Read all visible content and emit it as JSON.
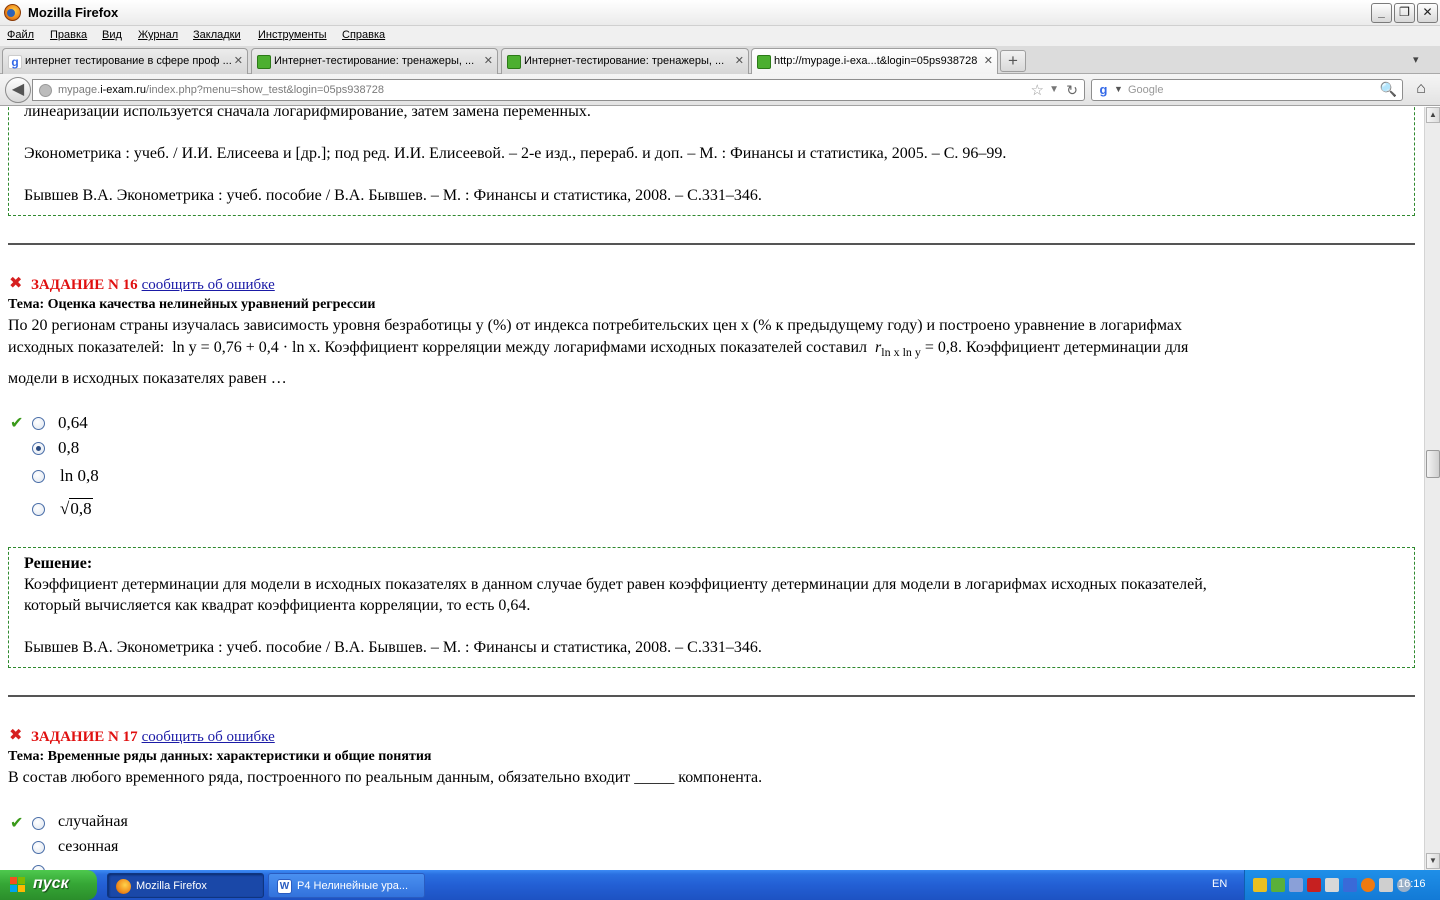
{
  "window": {
    "title": "Mozilla Firefox",
    "buttons": {
      "minimize": "_",
      "maximize": "❐",
      "close": "✕"
    }
  },
  "menu": [
    "Файл",
    "Правка",
    "Вид",
    "Журнал",
    "Закладки",
    "Инструменты",
    "Справка"
  ],
  "tabs": [
    {
      "label": "интернет тестирование в сфере проф ...",
      "close": "✕",
      "icon": "google-icon"
    },
    {
      "label": "Интернет-тестирование: тренажеры, ...",
      "close": "✕",
      "icon": "iexam-icon"
    },
    {
      "label": "Интернет-тестирование: тренажеры, ...",
      "close": "✕",
      "icon": "iexam-icon"
    },
    {
      "label": "http://mypage.i-exa...t&login=05ps938728",
      "close": "✕",
      "icon": "iexam-icon"
    }
  ],
  "new_tab": "+",
  "tabs_dropdown": "▾",
  "nav": {
    "back": "◀",
    "url_prefix": "mypage.",
    "url_domain": "i-exam.ru",
    "url_rest": "/index.php?menu=show_test&login=05ps938728",
    "star": "☆",
    "dropdown": "▼",
    "reload": "↻",
    "search_engine": "g",
    "search_dropdown": "▼",
    "search_placeholder": "Google",
    "search_button": "🔍",
    "home": "⌂"
  },
  "content": {
    "prev_solution": {
      "line_cut": "линеаризации используется сначала логарифмирование, затем замена переменных.",
      "ref1": "Эконометрика : учеб. / И.И. Елисеева и [др.]; под ред. И.И. Елисеевой. – 2-е изд., перераб. и доп. – М. : Финансы и статистика, 2005. – С. 96–99.",
      "ref2": "Бывшев В.А. Эконометрика : учеб. пособие / В.А. Бывшев. – М. : Финансы и статистика, 2008. – С.331–346."
    },
    "task16": {
      "title": "ЗАДАНИЕ N 16",
      "report": "сообщить об ошибке",
      "topic": "Тема: Оценка качества нелинейных уравнений регрессии",
      "q_line1": "По 20 регионам страны изучалась зависимость уровня безработицы y (%) от индекса потребительских цен x (% к предыдущему году) и построено уравнение в логарифмах",
      "q_line2_a": "исходных показателей:",
      "formula": "ln y = 0,76 + 0,4 · ln x",
      "q_line2_b": ". Коэффициент корреляции между логарифмами исходных показателей составил",
      "corr_formula": "r",
      "corr_sub": "ln x ln y",
      "corr_value": "= 0,8",
      "q_line2_c": ". Коэффициент детерминации для",
      "q_line3": "модели в исходных показателях равен …",
      "options": [
        "0,64",
        "0,8",
        "ln 0,8",
        "0,8"
      ],
      "correct_index": 0,
      "selected_index": 1,
      "solution_title": "Решение:",
      "solution_line1": "Коэффициент детерминации для модели в исходных показателях в данном случае будет равен коэффициенту детерминации для модели в логарифмах исходных показателей,",
      "solution_line2": "который вычисляется как квадрат коэффициента корреляции, то есть 0,64.",
      "solution_ref": "Бывшев В.А. Эконометрика : учеб. пособие / В.А. Бывшев. –  М. : Финансы и статистика, 2008. – С.331–346."
    },
    "task17": {
      "title": "ЗАДАНИЕ N 17",
      "report": "сообщить об ошибке",
      "topic": "Тема: Временные ряды данных: характеристики и общие понятия",
      "question": "В состав любого временного ряда, построенного по реальным данным, обязательно входит _____ компонента.",
      "options": [
        "случайная",
        "сезонная"
      ],
      "correct_index": 0
    }
  },
  "taskbar": {
    "start": "пуск",
    "items": [
      "Mozilla Firefox",
      "P4 Нелинейные ура..."
    ],
    "lang": "EN",
    "time": "16:16"
  },
  "colors": {
    "task_title": "#e01010",
    "link": "#1a1aa6",
    "solution_border": "#2f8a2f",
    "taskbar": "#235fd4",
    "start": "#36a736"
  }
}
